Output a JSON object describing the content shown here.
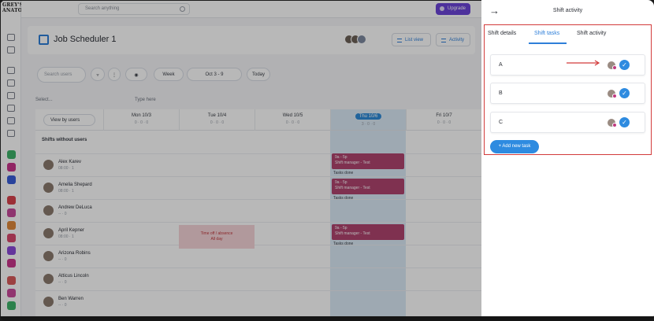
{
  "app": {
    "logo": "GREY'S ANATOMY",
    "search_placeholder": "Search anything",
    "upgrade_label": "Upgrade",
    "title": "Job Scheduler 1",
    "list_view_label": "List view",
    "activity_label": "Activity"
  },
  "toolbar": {
    "search_placeholder": "Search users",
    "range_label": "Week",
    "date_range": "Oct 3 - 9",
    "today_label": "Today",
    "filter_select": "Select...",
    "type_here": "Type here"
  },
  "grid": {
    "view_by": "View by users",
    "shifts_without_users": "Shifts without users",
    "days": [
      {
        "label": "Mon 10/3"
      },
      {
        "label": "Tue 10/4"
      },
      {
        "label": "Wed 10/5"
      },
      {
        "label": "Thu 10/6"
      },
      {
        "label": "Fri 10/7"
      }
    ],
    "users": [
      {
        "name": "Alex Karev",
        "meta": "08:00 · 1"
      },
      {
        "name": "Amelia Shepard",
        "meta": "08:00 · 1"
      },
      {
        "name": "Andrew DeLuca",
        "meta": "-- · 0"
      },
      {
        "name": "April Kepner",
        "meta": "08:00 · 1"
      },
      {
        "name": "Arizona Robins",
        "meta": "-- · 0"
      },
      {
        "name": "Atticus Lincoln",
        "meta": "-- · 0"
      },
      {
        "name": "Ben Warren",
        "meta": "-- · 0"
      }
    ],
    "shift_time": "9a - 5p",
    "shift_role": "Shift manager - Test",
    "tasks_done": "Tasks done",
    "absence_title": "Time off / absence",
    "absence_sub": "All day"
  },
  "panel": {
    "title": "Shift activity",
    "tabs": [
      "Shift details",
      "Shift tasks",
      "Shift activity"
    ],
    "active_tab": "Shift tasks",
    "tasks": [
      {
        "label": "A"
      },
      {
        "label": "B"
      },
      {
        "label": "C"
      }
    ],
    "add_task_label": "+ Add new task",
    "colors": {
      "accent": "#2e8be0",
      "highlight_border": "#d23b3b",
      "shift": "#b04470",
      "upgrade": "#6b45d8"
    }
  }
}
